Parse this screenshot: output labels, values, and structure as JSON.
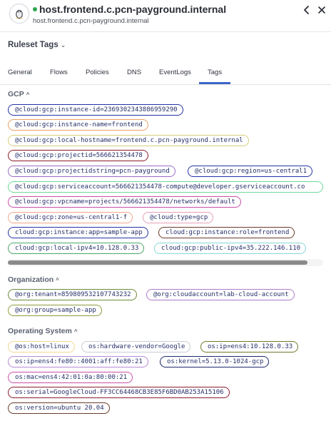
{
  "header": {
    "title": "host.frontend.c.pcn-payground.internal",
    "subtitle": "host.frontend.c.pcn-payground.internal",
    "status_color": "#2ea44f",
    "os_icon": "linux-penguin-icon",
    "back_icon": "chevron-left-icon",
    "close_icon": "close-icon"
  },
  "ruleset": {
    "label": "Ruleset Tags",
    "caret": "⌄"
  },
  "tabs": [
    "General",
    "Flows",
    "Policies",
    "DNS",
    "EventLogs",
    "Tags"
  ],
  "active_tab": "Tags",
  "sections": {
    "gcp": {
      "title": "GCP",
      "caret": "^",
      "tags": [
        {
          "text": "@cloud:gcp:instance-id=2369302343886959290",
          "color": "#2432a8"
        },
        {
          "text": "@cloud:gcp:instance-name=frontend",
          "color": "#e8a066"
        },
        {
          "text": "@cloud:gcp:local-hostname=frontend.c.pcn-payground.internal",
          "color": "#d4ce7a"
        },
        {
          "text": "@cloud:gcp:projectid=566621354478",
          "color": "#8a1c2c"
        },
        {
          "text": "@cloud:gcp:projectidstring=pcn-payground",
          "color": "#9a6ac8"
        },
        {
          "text": "@cloud:gcp:region=us-central1",
          "color": "#2432a8"
        },
        {
          "text": "@cloud:gcp:serviceaccount=566621354478-compute@developer.gserviceaccount.co",
          "color": "#6ed89a"
        },
        {
          "text": "@cloud:gcp:vpcname=projects/566621354478/networks/default",
          "color": "#c84fa8"
        },
        {
          "text": "@cloud:gcp:zone=us-central1-f",
          "color": "#f0a888"
        },
        {
          "text": "@cloud:type=gcp",
          "color": "#e6a0b8"
        },
        {
          "text": "cloud:gcp:instance:app=sample-app",
          "color": "#2432a8"
        },
        {
          "text": "cloud:gcp:instance:role=frontend",
          "color": "#6b3a2a"
        },
        {
          "text": "cloud:gcp:local-ipv4=10.128.0.33",
          "color": "#4aa866"
        },
        {
          "text": "cloud:gcp:public-ipv4=35.222.146.110",
          "color": "#86d6d6"
        }
      ]
    },
    "organization": {
      "title": "Organization",
      "caret": "^",
      "tags": [
        {
          "text": "@org:tenant=859809532107743232",
          "color": "#6b8a3a"
        },
        {
          "text": "@org:cloudaccount=lab-cloud-account",
          "color": "#b07ac8"
        },
        {
          "text": "@org:group=sample-app",
          "color": "#8e9a3a"
        }
      ]
    },
    "operating_system": {
      "title": "Operating System",
      "caret": "^",
      "tags": [
        {
          "text": "@os:host=linux",
          "color": "#f0d890"
        },
        {
          "text": "os:hardware-vendor=Google",
          "color": "#c8ccd2"
        },
        {
          "text": "os:ip=ens4:10.128.0.33",
          "color": "#6e7a2a"
        },
        {
          "text": "os:ip=ens4:fe80::4001:aff:fe80:21",
          "color": "#b88ad6"
        },
        {
          "text": "os:kernel=5.13.0-1024-gcp",
          "color": "#1e2a6e"
        },
        {
          "text": "os:mac=ens4:42:01:0a:80:00:21",
          "color": "#c84fa8"
        },
        {
          "text": "os:serial=GoogleCloud-FF3CC64468CB3E85F6BD0AB253A15106",
          "color": "#8a1c2c"
        },
        {
          "text": "os:version=ubuntu 20.04",
          "color": "#6b3a2a"
        }
      ]
    }
  }
}
